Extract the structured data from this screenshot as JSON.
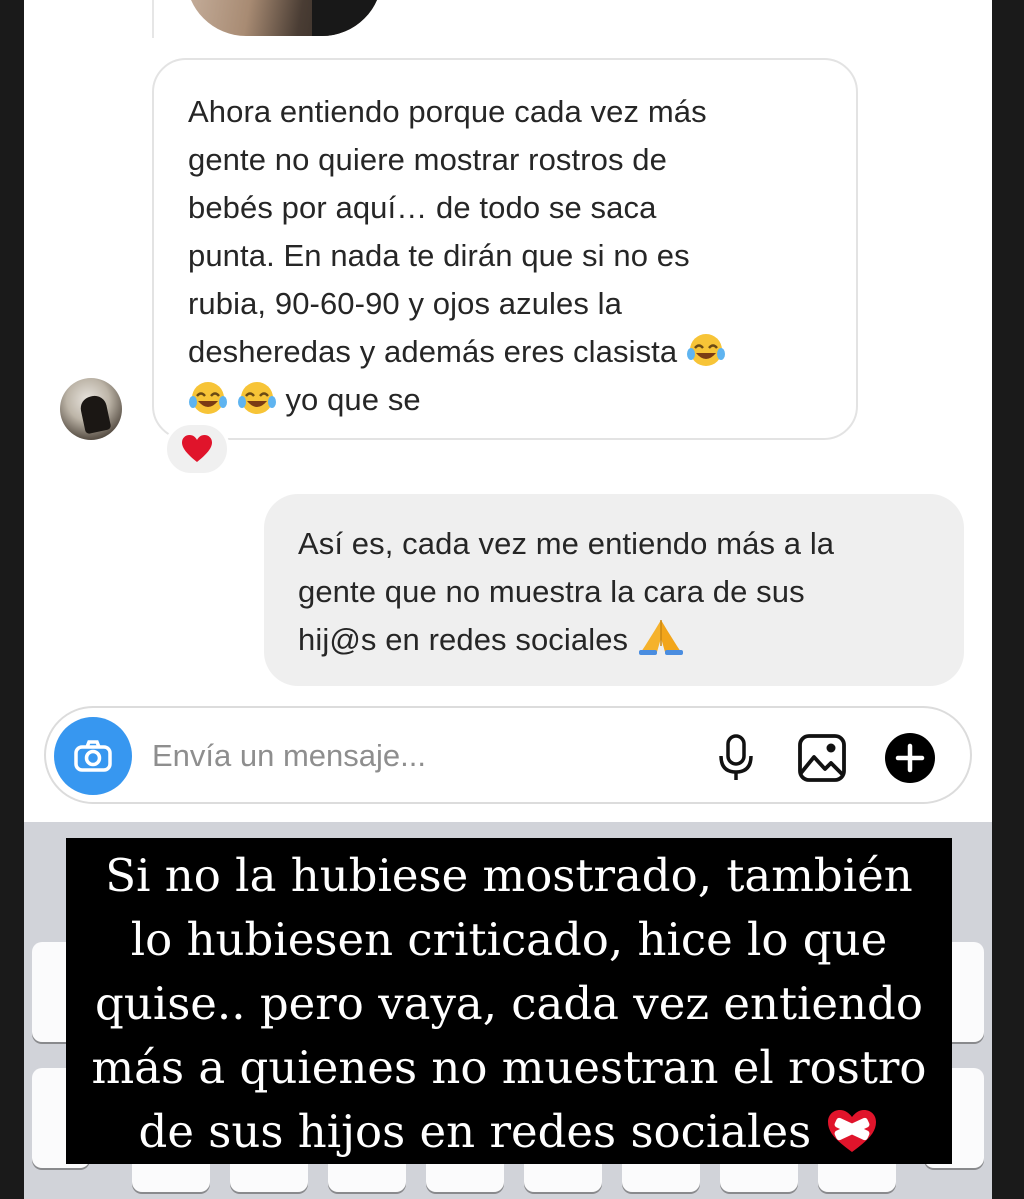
{
  "thread": {
    "received_message": {
      "lines": [
        "Ahora entiendo porque cada vez más",
        "gente no quiere mostrar rostros de",
        "bebés por aquí… de todo se saca",
        "punta. En nada te dirán que si no es",
        "rubia, 90-60-90 y ojos azules la",
        "desheredas y además eres clasista",
        "yo que se"
      ],
      "emoji": "face-with-tears-of-joy",
      "reaction": "red-heart"
    },
    "sent_message": {
      "lines": [
        "Así es, cada vez me entiendo más a la",
        "gente que no muestra la cara de sus",
        "hij@s en redes sociales"
      ],
      "emoji": "folded-hands"
    }
  },
  "composer": {
    "placeholder": "Envía un mensaje...",
    "icons": [
      "camera-icon",
      "microphone-icon",
      "image-icon",
      "add-icon"
    ],
    "accent_color": "#3797f0"
  },
  "story_caption": {
    "lines": [
      "Si no la hubiese mostrado, también",
      "lo hubiesen criticado, hice lo que",
      "quise.. pero vaya, cada vez entiendo",
      "más a quienes no muestran el rostro",
      "de sus hijos en redes sociales"
    ],
    "emoji": "mending-heart"
  }
}
